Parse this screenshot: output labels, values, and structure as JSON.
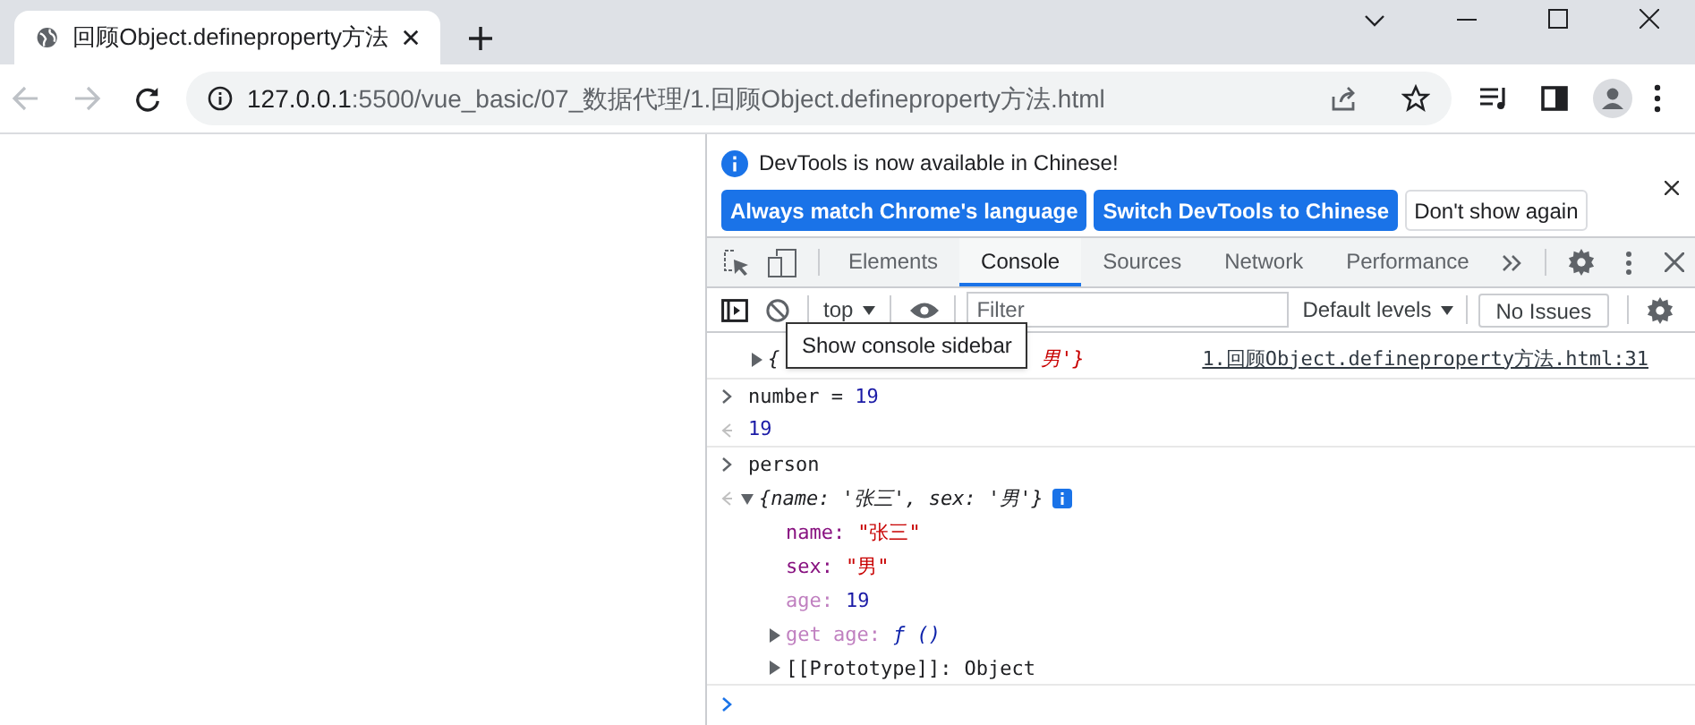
{
  "browser": {
    "tab": {
      "title": "回顾Object.defineproperty方法",
      "selected": true
    },
    "url": {
      "host": "127.0.0.1",
      "rest": ":5500/vue_basic/07_数据代理/1.回顾Object.defineproperty方法.html"
    }
  },
  "devtools": {
    "banner": {
      "message": "DevTools is now available in Chinese!",
      "buttons": [
        {
          "label": "Always match Chrome's language",
          "kind": "primary"
        },
        {
          "label": "Switch DevTools to Chinese",
          "kind": "primary"
        },
        {
          "label": "Don't show again",
          "kind": "secondary"
        }
      ]
    },
    "tabs": [
      {
        "label": "Elements",
        "selected": false
      },
      {
        "label": "Console",
        "selected": true
      },
      {
        "label": "Sources",
        "selected": false
      },
      {
        "label": "Network",
        "selected": false
      },
      {
        "label": "Performance",
        "selected": false
      }
    ],
    "toolbar": {
      "context": "top",
      "filter_placeholder": "Filter",
      "levels": "Default levels",
      "issues": "No Issues"
    },
    "tooltip": "Show console sidebar",
    "console": [
      {
        "kind": "log",
        "start": "{",
        "end": "男'}",
        "source": "1.回顾Object.defineproperty方法.html:31"
      },
      {
        "kind": "input",
        "text": "number = ",
        "value": "19"
      },
      {
        "kind": "output",
        "value": "19"
      },
      {
        "kind": "input",
        "text": "person"
      },
      {
        "kind": "object",
        "preview": "{name: '张三', sex: '男'}",
        "properties": [
          {
            "kind": "string",
            "key": "name:",
            "value": "\"张三\""
          },
          {
            "kind": "string",
            "key": "sex:",
            "value": "\"男\""
          },
          {
            "kind": "number",
            "key": "age:",
            "value": "19"
          },
          {
            "kind": "getter",
            "key": "get age:",
            "value": "ƒ ()"
          },
          {
            "kind": "proto",
            "key": "[[Prototype]]:",
            "value": "Object"
          }
        ]
      },
      {
        "kind": "prompt"
      }
    ]
  }
}
